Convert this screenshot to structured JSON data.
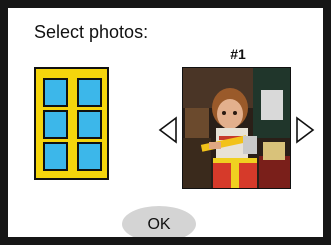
{
  "dialog": {
    "title": "Select photos:",
    "photo_counter": "#1",
    "ok_label": "OK",
    "layout_icon": "six-up-photo-layout-icon",
    "prev_icon": "triangle-left-outline-icon",
    "next_icon": "triangle-right-outline-icon",
    "layout_count": 6
  },
  "colors": {
    "frame": "#161616",
    "layout_fill": "#f5d50c",
    "cell_fill": "#3cb7ea",
    "button": "#d4d4d4"
  }
}
